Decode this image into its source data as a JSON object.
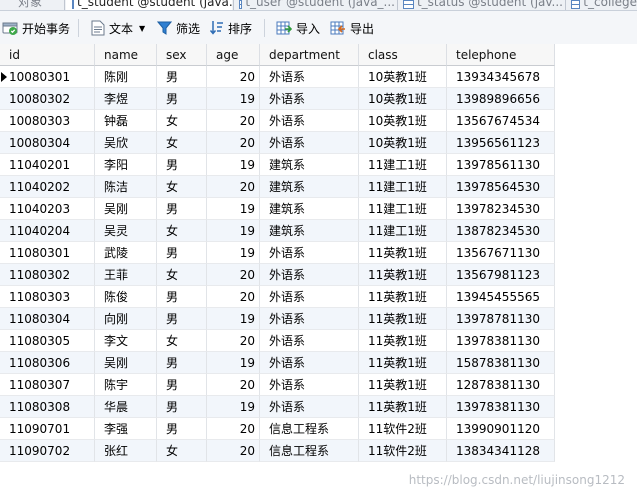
{
  "tabs": [
    {
      "label": "对象"
    },
    {
      "label": "t_student @student (java..."
    },
    {
      "label": "t_user @student (java_..."
    },
    {
      "label": "t_status @student (jav..."
    },
    {
      "label": "t_college"
    }
  ],
  "toolbar": {
    "begin_transaction": "开始事务",
    "text": "文本",
    "filter": "筛选",
    "sort": "排序",
    "import": "导入",
    "export": "导出"
  },
  "columns": [
    "id",
    "name",
    "sex",
    "age",
    "department",
    "class",
    "telephone"
  ],
  "rows": [
    [
      "10080301",
      "陈刚",
      "男",
      "20",
      "外语系",
      "10英教1班",
      "13934345678"
    ],
    [
      "10080302",
      "李煜",
      "男",
      "19",
      "外语系",
      "10英教1班",
      "13989896656"
    ],
    [
      "10080303",
      "钟磊",
      "女",
      "20",
      "外语系",
      "10英教1班",
      "13567674534"
    ],
    [
      "10080304",
      "吴欣",
      "女",
      "20",
      "外语系",
      "10英教1班",
      "13956561123"
    ],
    [
      "11040201",
      "李阳",
      "男",
      "19",
      "建筑系",
      "11建工1班",
      "13978561130"
    ],
    [
      "11040202",
      "陈洁",
      "女",
      "20",
      "建筑系",
      "11建工1班",
      "13978564530"
    ],
    [
      "11040203",
      "吴刚",
      "男",
      "19",
      "建筑系",
      "11建工1班",
      "13978234530"
    ],
    [
      "11040204",
      "吴灵",
      "女",
      "19",
      "建筑系",
      "11建工1班",
      "13878234530"
    ],
    [
      "11080301",
      "武陵",
      "男",
      "19",
      "外语系",
      "11英教1班",
      "13567671130"
    ],
    [
      "11080302",
      "王菲",
      "女",
      "20",
      "外语系",
      "11英教1班",
      "13567981123"
    ],
    [
      "11080303",
      "陈俊",
      "男",
      "20",
      "外语系",
      "11英教1班",
      "13945455565"
    ],
    [
      "11080304",
      "向刚",
      "男",
      "19",
      "外语系",
      "11英教1班",
      "13978781130"
    ],
    [
      "11080305",
      "李文",
      "女",
      "20",
      "外语系",
      "11英教1班",
      "13978381130"
    ],
    [
      "11080306",
      "吴刚",
      "男",
      "19",
      "外语系",
      "11英教1班",
      "15878381130"
    ],
    [
      "11080307",
      "陈宇",
      "男",
      "20",
      "外语系",
      "11英教1班",
      "12878381130"
    ],
    [
      "11080308",
      "华晨",
      "男",
      "19",
      "外语系",
      "11英教1班",
      "13978381130"
    ],
    [
      "11090701",
      "李强",
      "男",
      "20",
      "信息工程系",
      "11软件2班",
      "13990901120"
    ],
    [
      "11090702",
      "张红",
      "女",
      "20",
      "信息工程系",
      "11软件2班",
      "13834341128"
    ]
  ],
  "watermark": "https://blog.csdn.net/liujinsong1212"
}
